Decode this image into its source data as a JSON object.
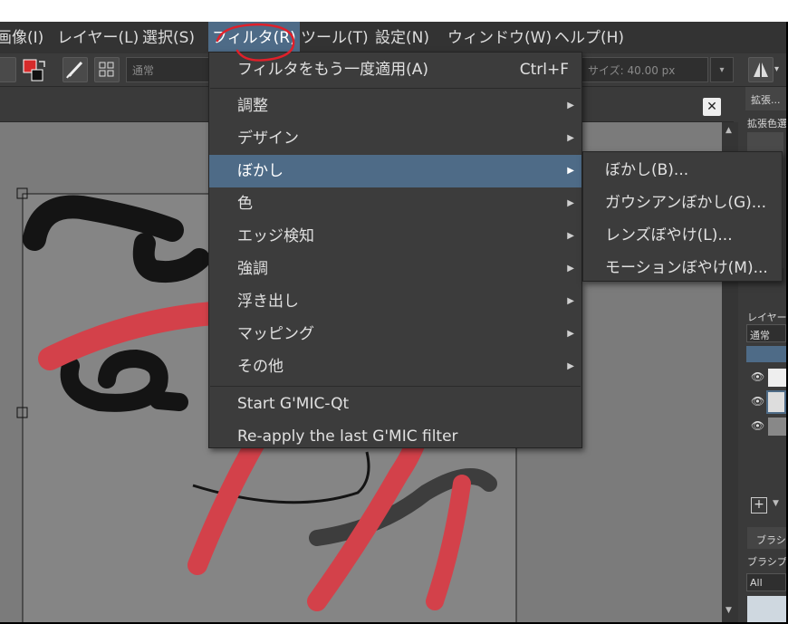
{
  "menubar": {
    "items": [
      {
        "label": "画像(I)",
        "underline": "I"
      },
      {
        "label": "レイヤー(L)",
        "underline": "L"
      },
      {
        "label": "選択(S)",
        "underline": "S"
      },
      {
        "label": "フィルタ(R)",
        "underline": "R"
      },
      {
        "label": "ツール(T)",
        "underline": "T"
      },
      {
        "label": "設定(N)",
        "underline": "N"
      },
      {
        "label": "ウィンドウ(W)",
        "underline": "W"
      },
      {
        "label": "ヘルプ(H)",
        "underline": "H"
      }
    ]
  },
  "toolbar": {
    "blend_mode": "通常",
    "size_label": "サイズ: 40.00 px"
  },
  "filters_menu": {
    "reapply_label": "フィルタをもう一度適用(A)",
    "reapply_shortcut": "Ctrl+F",
    "categories": [
      "調整",
      "デザイン",
      "ぼかし",
      "色",
      "エッジ検知",
      "強調",
      "浮き出し",
      "マッピング",
      "その他"
    ],
    "gmic_start": "Start G'MIC-Qt",
    "gmic_reapply": "Re-apply the last G'MIC filter"
  },
  "blur_submenu": {
    "items": [
      "ぼかし(B)...",
      "ガウシアンぼかし(G)...",
      "レンズぼやけ(L)...",
      "モーションぼやけ(M)..."
    ]
  },
  "right_dock": {
    "tab1": "拡張...",
    "tab1_sub": "拡張色選",
    "layers_label": "レイヤー",
    "layers_blend": "通常",
    "brush_tab": "ブラシプ",
    "brush_sub": "ブラシプリ",
    "brush_filter": "All"
  },
  "colors": {
    "menu_highlight": "#4e6b87",
    "annotation_red": "#e0202a"
  }
}
